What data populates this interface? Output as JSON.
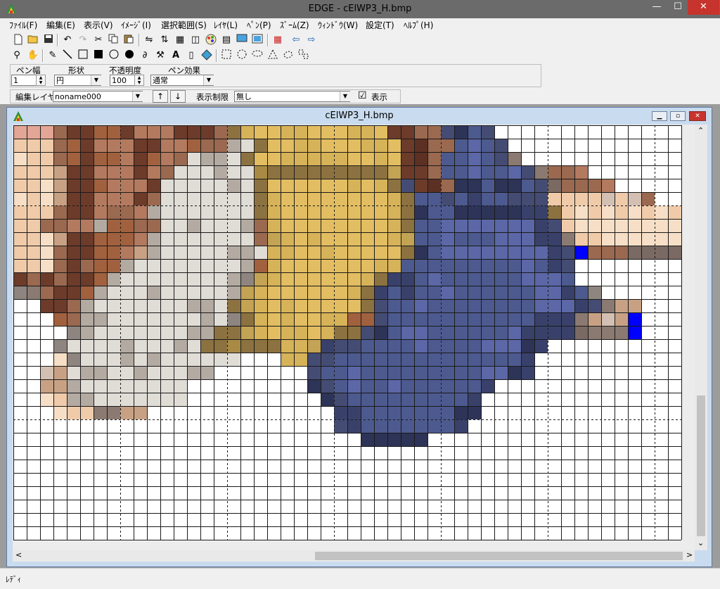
{
  "window": {
    "title": "EDGE - cElWP3_H.bmp",
    "min": "—",
    "max": "☐",
    "close": "✕"
  },
  "menu": [
    "ﾌｧｲﾙ(F)",
    "編集(E)",
    "表示(V)",
    "ｲﾒｰｼﾞ(I)",
    "選択範囲(S)",
    "ﾚｲﾔ(L)",
    "ﾍﾟﾝ(P)",
    "ｽﾞｰﾑ(Z)",
    "ｳｨﾝﾄﾞｳ(W)",
    "設定(T)",
    "ﾍﾙﾌﾟ(H)"
  ],
  "toolbar1": [
    "new-icon",
    "open-icon",
    "save-icon",
    "undo-icon",
    "redo-icon",
    "cut-icon",
    "copy-icon",
    "paste-icon",
    "flip-h-icon",
    "flip-v-icon",
    "grid-icon",
    "layer-icon",
    "palette-icon",
    "film-icon",
    "screen-icon",
    "monitor-icon",
    "tile-grid-icon",
    "prev-icon",
    "next-icon"
  ],
  "toolbar2": [
    "zoom-icon",
    "hand-icon",
    "pen-icon",
    "line-icon",
    "rect-icon",
    "filled-rect-icon",
    "circle-icon",
    "filled-circle-icon",
    "curve-icon",
    "hammer-icon",
    "text-icon",
    "bucket-icon",
    "fill-icon",
    "select-rect-icon",
    "select-circle-icon",
    "select-lasso-icon",
    "select-poly-icon",
    "select-free-icon",
    "select-color-icon"
  ],
  "pen": {
    "width_label": "ペン幅",
    "width_value": "1",
    "shape_label": "形状",
    "shape_value": "円",
    "opacity_label": "不透明度",
    "opacity_value": "100",
    "effect_label": "ペン効果",
    "effect_value": "通常"
  },
  "layer": {
    "edit_label": "編集レイヤ",
    "edit_value": "noname000",
    "up_label": "↑",
    "down_label": "↓",
    "display_limit_label": "表示制限",
    "display_limit_value": "無し",
    "show_checkbox": "☑",
    "show_label": "表示"
  },
  "child": {
    "title": "cElWP3_H.bmp",
    "min": "▁",
    "max": "▫",
    "close": "✕"
  },
  "scroll": {
    "up": "⌃",
    "down": "⌄",
    "left": "<",
    "right": ">"
  },
  "status": {
    "text": "ﾚﾃﾞｨ"
  },
  "pixel_palette": {
    ".": "#ffffff",
    "a": "#e3a595",
    "b": "#f0cba9",
    "c": "#f6dfc6",
    "d": "#c8a184",
    "e": "#9a6950",
    "f": "#6d3b2a",
    "g": "#b37a5f",
    "h": "#a1613f",
    "i": "#5c3022",
    "j": "#e0dcd6",
    "k": "#b3aaa2",
    "l": "#8f8580",
    "m": "#7a6a63",
    "n": "#8c7240",
    "o": "#a88a44",
    "p": "#d6b258",
    "q": "#e2bd62",
    "r": "#c3a354",
    "s": "#454c73",
    "t": "#5b67a6",
    "u": "#4d5a8f",
    "v": "#39416b",
    "w": "#2d3458",
    "x": "#0000ff",
    "y": "#d3c0b3",
    "z": "#8a7a71"
  },
  "pixel_rows": [
    "aaaeffhhfgggfffenpqqppqqqppqffeeswus..................................",
    "bbbehfgggffggheekjnqqppqqqppqfieeutus.................................",
    "cbbehfhhgfhgejkkjnqqpppppqqpqfieuutusz................................",
    "bbbdffgggfgejjjkjjonnnnnnnnnrffeuutuutszeeg...........................",
    "bbcdffhgggfjjjjjkjnqqqqqqpqpnsfiewwuwwusmeeeg.........................",
    "cbcdffgggfejjjjjjjnpqqqqqqqqpnuusuvuusssbbbbybye......................",
    "bbbeffgeegkjjjjjjjnpqqqqqqqqpnwuuwwwwwvvnbcbcbcbcbbe..................",
    "bbeeggkhheejjkjjjkepqqqqqqqqpnuutttttttvsbccccccccccx.................",
    "bbcdffhhhgkjjjjjjjerpqpqqqqqpruutuuutttvvzbbccccccccx.................",
    "bbceffhhgdkjjjjjkkjppqqpqqqqqnwuttttttttvsxeeemmmmmmm.................",
    "bbcefehhkjjjjjjjjkhpqqqqqqqppuuuuuuuuutuvs............................",
    "fefeffhkjjjjjjjjklrpqqqqqqpnvvutuuuuuutttu............................",
    "lzeffhkjjjkjjjjjkrpqqqqqqpnvuvuutuuuuuuttvul..........................",
    "..ffekjjjjjjjkkjnrpqpqqqqqnsuutuuuuuuuutttvszdd.......................",
    "...hekkjjjjjjjkjlnpqpqqpphhsuuuuuuuuuuuvvvzdydx.......................",
    "....lkjjjjjjjkknnrpqppqpnnswuttuuuuuutvvvvmzzzx.......................",
    "...ljjjjkjjjkjnnonnnpprvssuuuutuuuutttwv..............................",
    "...cljjjkjkjjjjjj...ppssuuuuuuuuuuuuuuv...............................",
    "..ydjkkjjkjjjkk.......suutuuuuuuuuuttwv...............................",
    "..ddkjjjjjjjj.........wsutuutuuuuuuv..................................",
    "..cbkkjjjjjjj..........wsuuuuuuuuuv...................................",
    "...cbbzzdd..............vvuuuuuuuww...................................",
    "........................svuuuuuuuv....................................",
    "..........................wwwww.......................................",
    "......................................................................",
    "......................................................................",
    "......................................................................",
    "......................................................................",
    "......................................................................",
    "......................................................................",
    "......................................................................",
    "......................................................................"
  ]
}
